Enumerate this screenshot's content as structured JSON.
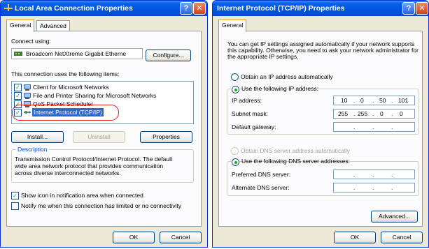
{
  "win1": {
    "title": "Local Area Connection Properties",
    "tabs": [
      "General",
      "Advanced"
    ],
    "connect_using_label": "Connect using:",
    "adapter_name": "Broadcom NetXtreme Gigabit Etherne",
    "configure_button": "Configure...",
    "components_label": "This connection uses the following items:",
    "components": [
      {
        "label": "Client for Microsoft Networks",
        "checked": true,
        "icon": "network-client-icon"
      },
      {
        "label": "File and Printer Sharing for Microsoft Networks",
        "checked": true,
        "icon": "file-printer-sharing-icon"
      },
      {
        "label": "QoS Packet Scheduler",
        "checked": true,
        "icon": "qos-scheduler-icon"
      },
      {
        "label": "Internet Protocol (TCP/IP)",
        "checked": true,
        "icon": "protocol-icon",
        "selected": true
      }
    ],
    "install_button": "Install...",
    "uninstall_button": "Uninstall",
    "properties_button": "Properties",
    "description_label": "Description",
    "description_text_1": "Transmission Control Protocol/Internet Protocol. The default",
    "description_text_2": "wide area network protocol that provides communication",
    "description_text_3": "across diverse interconnected networks.",
    "show_icon_label": "Show icon in notification area when connected",
    "notify_label": "Notify me when this connection has limited or no connectivity",
    "ok_button": "OK",
    "cancel_button": "Cancel"
  },
  "win2": {
    "title": "Internet Protocol (TCP/IP) Properties",
    "tab": "General",
    "intro_1": "You can get IP settings assigned automatically if your network supports",
    "intro_2": "this capability. Otherwise, you need to ask your network administrator for",
    "intro_3": "the appropriate IP settings.",
    "obtain_ip_auto": "Obtain an IP address automatically",
    "use_following_ip": "Use the following IP address:",
    "ip_label": "IP address:",
    "ip_value": [
      "10",
      "0",
      "50",
      "101"
    ],
    "subnet_label": "Subnet mask:",
    "subnet_value": [
      "255",
      "255",
      "0",
      "0"
    ],
    "gateway_label": "Default gateway:",
    "obtain_dns_auto": "Obtain DNS server address automatically",
    "use_following_dns": "Use the following DNS server addresses:",
    "preferred_dns_label": "Preferred DNS server:",
    "alternate_dns_label": "Alternate DNS server:",
    "advanced_button": "Advanced...",
    "ok_button": "OK",
    "cancel_button": "Cancel"
  },
  "colors": {
    "titlebar": "#0054e3",
    "highlight_oval": "#e02020",
    "selection": "#316ac5"
  }
}
